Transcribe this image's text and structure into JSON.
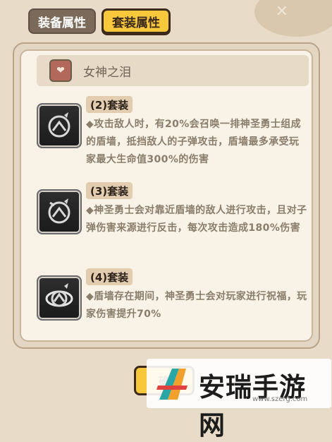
{
  "tabs": [
    {
      "label": "装备属性",
      "active": false
    },
    {
      "label": "套装属性",
      "active": true
    }
  ],
  "set": {
    "name": "女神之泪",
    "icon": "heart-emblem-icon"
  },
  "items": [
    {
      "tier": "(2)套装",
      "description": "◆攻击敌人时，有20%会召唤一排神圣勇士组成的盾墙，抵挡敌人的子弹攻击，盾墙最多承受玩家最大生命值300%的伤害",
      "icon": "shield-emblem-icon"
    },
    {
      "tier": "(3)套装",
      "description": "◆神圣勇士会对靠近盾墙的敌人进行攻击，且对子弹伤害来源进行反击，每次攻击造成180%伤害",
      "icon": "shield-emblem-icon"
    },
    {
      "tier": "(4)套装",
      "description": "◆盾墙存在期间，神圣勇士会对玩家进行祝福，玩家伤害提升70%",
      "icon": "shield-emblem-icon"
    }
  ],
  "confirm_label": "确",
  "watermark": {
    "text": "安瑞手游网",
    "url": "www.szerg.com"
  },
  "colors": {
    "accent": "#f7c83b",
    "tab_inactive": "#7b6a5a",
    "text_muted": "#8b7d6b"
  }
}
